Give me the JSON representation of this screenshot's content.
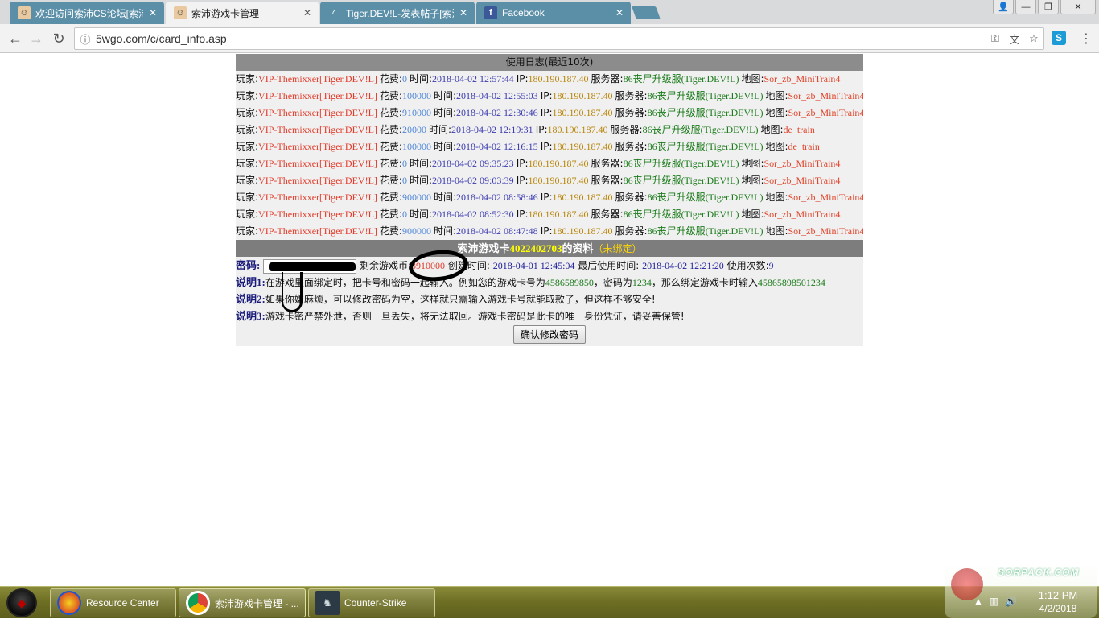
{
  "tabs": [
    {
      "title": "欢迎访问索沛CS论坛[索沛",
      "close": "✕"
    },
    {
      "title": "索沛游戏卡管理",
      "close": "✕"
    },
    {
      "title": "Tiger.DEV!L-发表帖子[索沛",
      "close": "✕"
    },
    {
      "title": "Facebook",
      "close": "✕"
    }
  ],
  "window_buttons": {
    "user": "👤",
    "minimize": "—",
    "restore": "❐",
    "close": "✕"
  },
  "nav": {
    "back": "←",
    "forward": "→",
    "reload": "↻"
  },
  "address": {
    "info_icon": "ⓘ",
    "url": "5wgo.com/c/card_info.asp"
  },
  "extension": {
    "label": "S"
  },
  "log": {
    "title": "使用日志(最近10次)",
    "labels": {
      "player": "玩家:",
      "cost": "花费:",
      "time": "时间:",
      "ip": "IP:",
      "server": "服务器:",
      "map": "地图:"
    },
    "rows": [
      {
        "player": "VIP-Themixxer[Tiger.DEV!L]",
        "cost": "0",
        "time": "2018-04-02 12:57:44",
        "ip": "180.190.187.40",
        "server": "86丧尸升级服(Tiger.DEV!L)",
        "map": "Sor_zb_MiniTrain4"
      },
      {
        "player": "VIP-Themixxer[Tiger.DEV!L]",
        "cost": "100000",
        "time": "2018-04-02 12:55:03",
        "ip": "180.190.187.40",
        "server": "86丧尸升级服(Tiger.DEV!L)",
        "map": "Sor_zb_MiniTrain4"
      },
      {
        "player": "VIP-Themixxer[Tiger.DEV!L]",
        "cost": "910000",
        "time": "2018-04-02 12:30:46",
        "ip": "180.190.187.40",
        "server": "86丧尸升级服(Tiger.DEV!L)",
        "map": "Sor_zb_MiniTrain4"
      },
      {
        "player": "VIP-Themixxer[Tiger.DEV!L]",
        "cost": "20000",
        "time": "2018-04-02 12:19:31",
        "ip": "180.190.187.40",
        "server": "86丧尸升级服(Tiger.DEV!L)",
        "map": "de_train"
      },
      {
        "player": "VIP-Themixxer[Tiger.DEV!L]",
        "cost": "100000",
        "time": "2018-04-02 12:16:15",
        "ip": "180.190.187.40",
        "server": "86丧尸升级服(Tiger.DEV!L)",
        "map": "de_train"
      },
      {
        "player": "VIP-Themixxer[Tiger.DEV!L]",
        "cost": "0",
        "time": "2018-04-02 09:35:23",
        "ip": "180.190.187.40",
        "server": "86丧尸升级服(Tiger.DEV!L)",
        "map": "Sor_zb_MiniTrain4"
      },
      {
        "player": "VIP-Themixxer[Tiger.DEV!L]",
        "cost": "0",
        "time": "2018-04-02 09:03:39",
        "ip": "180.190.187.40",
        "server": "86丧尸升级服(Tiger.DEV!L)",
        "map": "Sor_zb_MiniTrain4"
      },
      {
        "player": "VIP-Themixxer[Tiger.DEV!L]",
        "cost": "900000",
        "time": "2018-04-02 08:58:46",
        "ip": "180.190.187.40",
        "server": "86丧尸升级服(Tiger.DEV!L)",
        "map": "Sor_zb_MiniTrain4"
      },
      {
        "player": "VIP-Themixxer[Tiger.DEV!L]",
        "cost": "0",
        "time": "2018-04-02 08:52:30",
        "ip": "180.190.187.40",
        "server": "86丧尸升级服(Tiger.DEV!L)",
        "map": "Sor_zb_MiniTrain4"
      },
      {
        "player": "VIP-Themixxer[Tiger.DEV!L]",
        "cost": "900000",
        "time": "2018-04-02 08:47:48",
        "ip": "180.190.187.40",
        "server": "86丧尸升级服(Tiger.DEV!L)",
        "map": "Sor_zb_MiniTrain4"
      }
    ]
  },
  "card": {
    "title_prefix": "索沛游戏卡",
    "card_number": "4022402703",
    "title_suffix": "的资料",
    "status": "（未绑定）",
    "password_label": "密码:",
    "coins_label": "剩余游戏币:",
    "coins": "3910000",
    "created_label": "创建时间:",
    "created": "2018-04-01 12:45:04",
    "last_used_label": "最后使用时间:",
    "last_used": "2018-04-02 12:21:20",
    "uses_label": "使用次数:",
    "uses": "9",
    "note1_label": "说明1:",
    "note1_text": "在游戏里面绑定时，把卡号和密码一起输入。例如您的游戏卡号为",
    "note1_example_card": "4586589850",
    "note1_mid": "，密码为",
    "note1_example_pwd": "1234",
    "note1_after": "，那么绑定游戏卡时输入",
    "note1_example_combined": "45865898501234",
    "note2_label": "说明2:",
    "note2_text": "如果你嫌麻烦，可以修改密码为空，这样就只需输入游戏卡号就能取款了，但这样不够安全!",
    "note3_label": "说明3:",
    "note3_text": "游戏卡密严禁外泄，否则一旦丢失，将无法取回。游戏卡密码是此卡的唯一身份凭证，请妥善保管!",
    "confirm_button": "确认修改密码"
  },
  "taskbar": {
    "items": [
      {
        "label": "Resource Center"
      },
      {
        "label": "索沛游戏卡管理 - ..."
      },
      {
        "label": "Counter-Strike"
      }
    ],
    "watermark": "SORPACK.COM",
    "time": "1:12 PM",
    "date": "4/2/2018"
  },
  "colors": {
    "tab_inactive": "#5b8fa8",
    "header_bg": "#8c8c8c",
    "player": "#e23b2a",
    "cost": "#4f87d8",
    "time": "#3a3ab0",
    "ip": "#b8860b",
    "server": "#1b7b1b",
    "map": "#e0452c",
    "taskbar": "#6f7024"
  }
}
